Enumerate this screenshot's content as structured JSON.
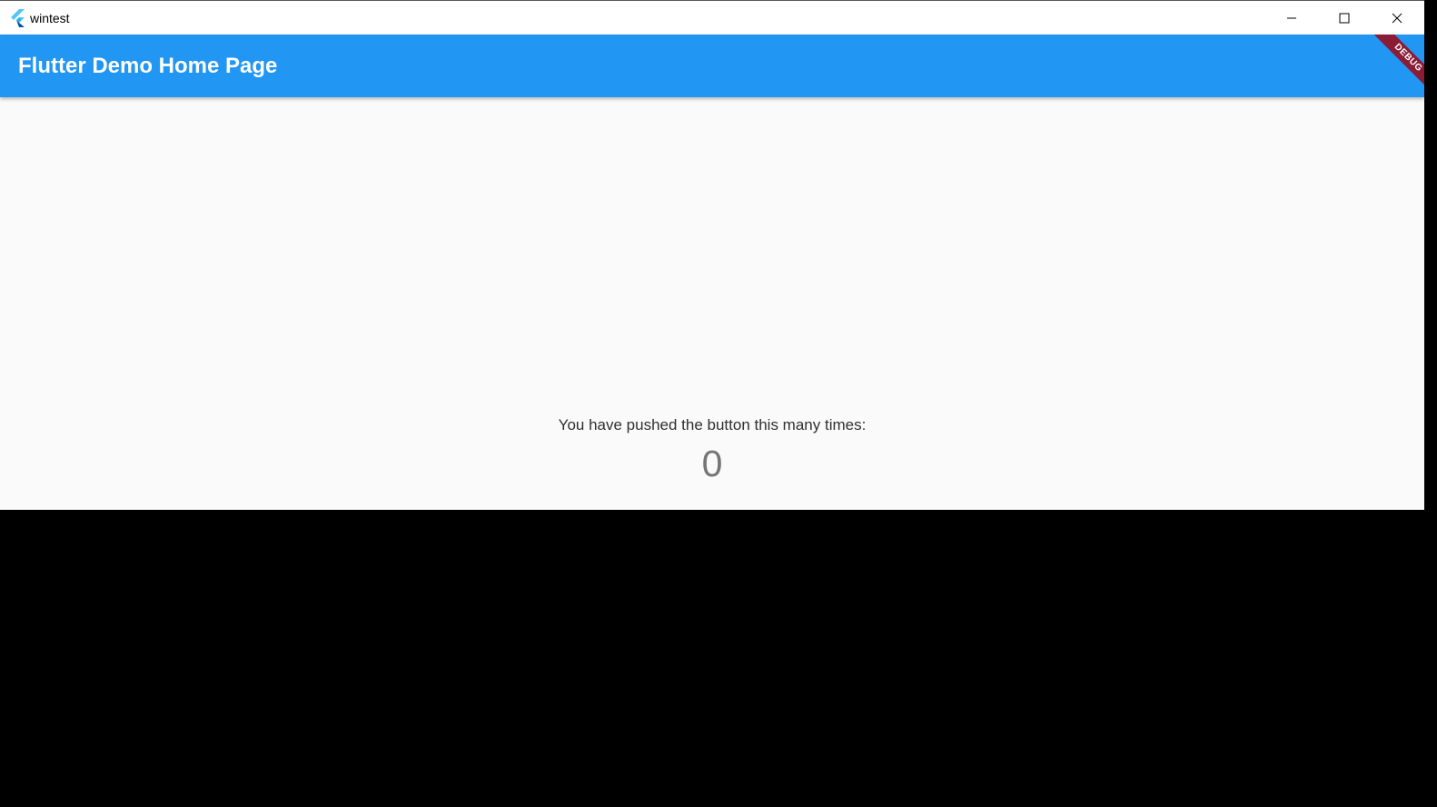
{
  "window": {
    "title": "wintest",
    "controls": {
      "minimize_icon": "minimize-icon",
      "maximize_icon": "maximize-icon",
      "close_icon": "close-icon"
    }
  },
  "appbar": {
    "title": "Flutter Demo Home Page",
    "color": "#2196f3"
  },
  "debug_banner": {
    "label": "DEBUG",
    "color": "#8b1c36"
  },
  "counter": {
    "label": "You have pushed the button this many times:",
    "value": "0"
  }
}
